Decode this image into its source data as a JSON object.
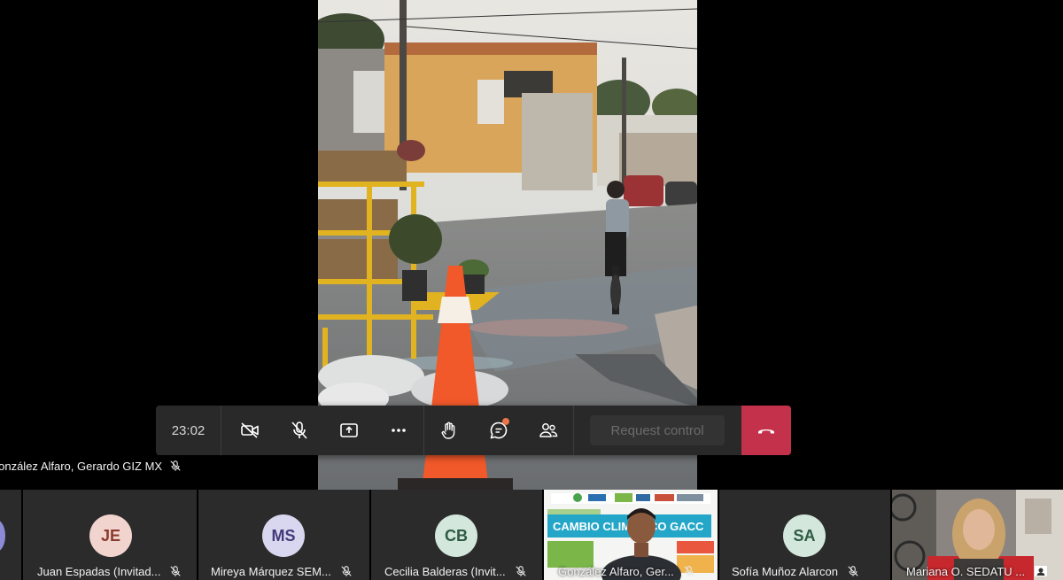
{
  "meeting": {
    "timer": "23:02",
    "speaker_label": "González Alfaro, Gerardo GIZ MX",
    "request_control": "Request control",
    "colors": {
      "hangup": "#c4314b",
      "bar": "#292929",
      "chat_badge": "#e97548"
    }
  },
  "controls": [
    {
      "icon": "camera-off-icon"
    },
    {
      "icon": "mic-off-icon"
    },
    {
      "icon": "share-screen-icon"
    },
    {
      "icon": "more-options-icon"
    },
    {
      "icon": "raise-hand-icon"
    },
    {
      "icon": "chat-icon"
    },
    {
      "icon": "participants-icon"
    },
    {
      "icon": "hang-up-icon"
    }
  ],
  "participants": [
    {
      "initials": "JE",
      "name": "Juan Espadas (Invitad...",
      "avatar_bg": "#f2d4cf",
      "avatar_fg": "#8a3b2f"
    },
    {
      "initials": "MS",
      "name": "Mireya Márquez SEM...",
      "avatar_bg": "#d9d6ef",
      "avatar_fg": "#413b7a"
    },
    {
      "initials": "CB",
      "name": "Cecilia Balderas (Invit...",
      "avatar_bg": "#d3e7dc",
      "avatar_fg": "#2d5b43"
    },
    {
      "initials": "",
      "name": "González Alfaro, Ger...",
      "video": true
    },
    {
      "initials": "SA",
      "name": "Sofía Muñoz Alarcon",
      "avatar_bg": "#d3e7dc",
      "avatar_fg": "#2d5b43"
    },
    {
      "initials": "",
      "name": "Mariana O. SEDATU ...",
      "video": true
    }
  ],
  "video_tile": {
    "banner_title": "CAMBIO CLIMÁTICO GACC"
  }
}
